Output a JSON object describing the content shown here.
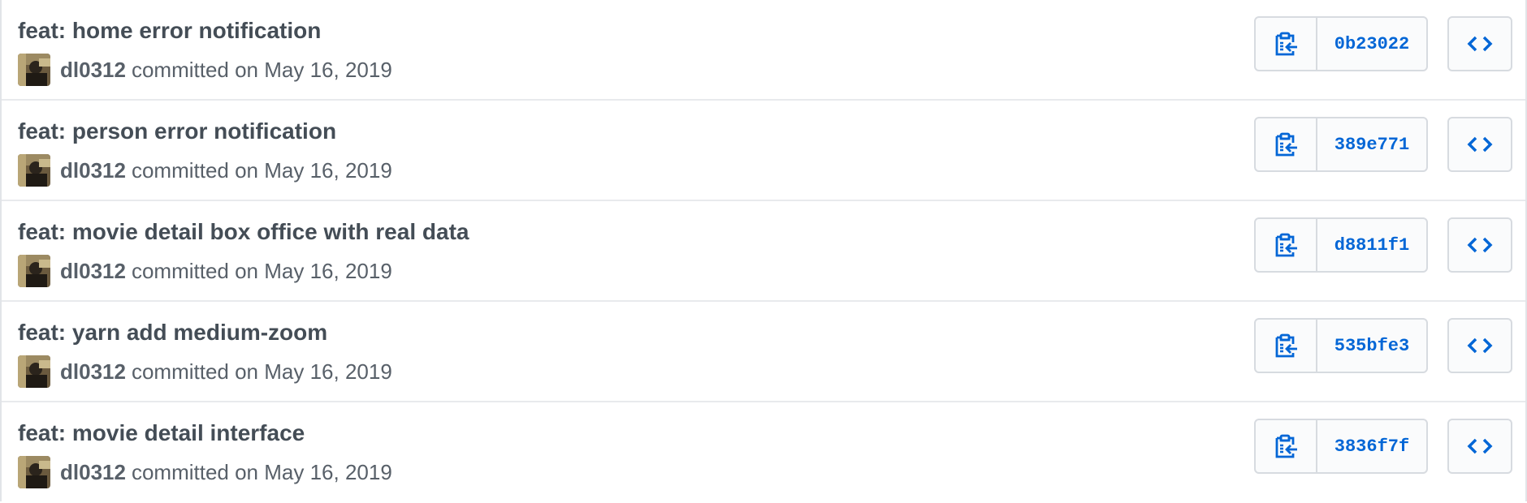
{
  "commits": [
    {
      "title": "feat: home error notification",
      "author": "dl0312",
      "date_text": "committed on May 16, 2019",
      "sha": "0b23022"
    },
    {
      "title": "feat: person error notification",
      "author": "dl0312",
      "date_text": "committed on May 16, 2019",
      "sha": "389e771"
    },
    {
      "title": "feat: movie detail box office with real data",
      "author": "dl0312",
      "date_text": "committed on May 16, 2019",
      "sha": "d8811f1"
    },
    {
      "title": "feat: yarn add medium-zoom",
      "author": "dl0312",
      "date_text": "committed on May 16, 2019",
      "sha": "535bfe3"
    },
    {
      "title": "feat: movie detail interface",
      "author": "dl0312",
      "date_text": "committed on May 16, 2019",
      "sha": "3836f7f"
    }
  ],
  "icons": {
    "copy": "clipboard-copy-icon",
    "browse": "code-brackets-icon"
  },
  "colors": {
    "link": "#0366d6",
    "title": "#444d56",
    "meta": "#586069",
    "border": "#d7dbe0"
  }
}
